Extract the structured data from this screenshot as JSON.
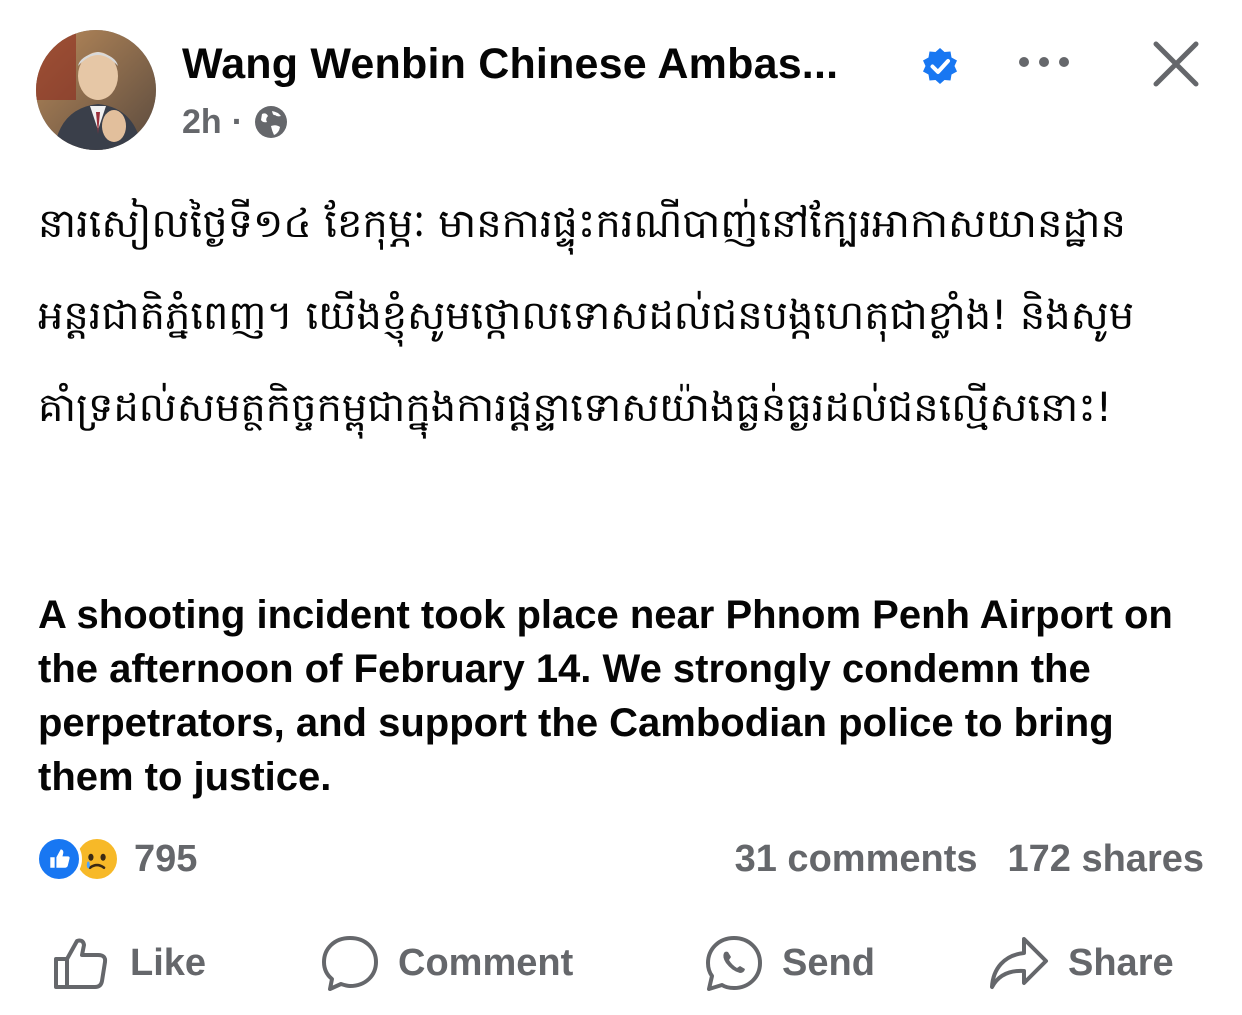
{
  "post": {
    "author": "Wang Wenbin Chinese Ambas...",
    "time": "2h",
    "separator": "·",
    "khmer_text": "នារសៀលថ្ងៃទី១៤ ខែកុម្ភៈ មានការផ្ទុះករណីបាញ់នៅក្បែរអាកាសយានដ្ឋានអន្តរជាតិភ្នំពេញ។ យើងខ្ញុំសូមថ្កោលទោសដល់ជនបង្កហេតុជាខ្លាំង! និងសូមគាំទ្រដល់សមត្ថកិច្ចកម្ពុជាក្នុងការផ្តន្ទាទោសយ៉ាងធ្ងន់ធ្ងរដល់ជនល្មើសនោះ!",
    "english_text": "A shooting incident took place near Phnom Penh Airport on the afternoon of February 14. We strongly condemn the perpetrators, and support the Cambodian police to bring them to justice."
  },
  "engagement": {
    "reaction_count": "795",
    "comments": "31 comments",
    "shares": "172 shares"
  },
  "actions": {
    "like": "Like",
    "comment": "Comment",
    "send": "Send",
    "share": "Share"
  },
  "icons": {
    "verified": "verified-badge-icon",
    "privacy": "globe-icon",
    "more": "more-options-icon",
    "close": "close-icon"
  },
  "colors": {
    "accent": "#1877f2",
    "text": "#050505",
    "secondary": "#65676b",
    "sad_reaction": "#f7b928"
  }
}
